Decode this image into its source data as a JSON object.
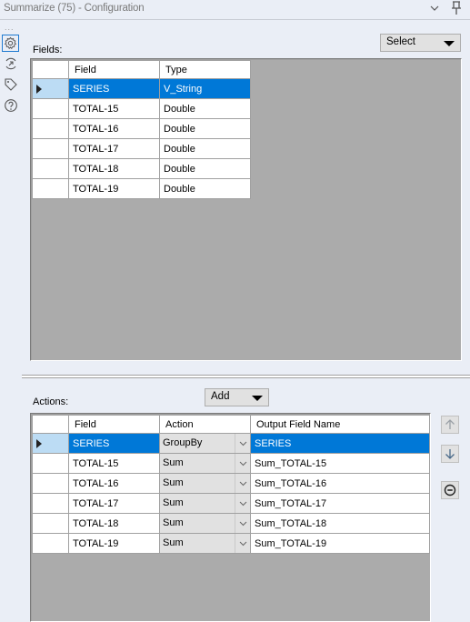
{
  "window": {
    "title": "Summarize (75) - Configuration"
  },
  "sidebar": {
    "more": "...",
    "items": [
      {
        "name": "configuration",
        "icon": "gear-icon",
        "active": true
      },
      {
        "name": "annotation",
        "icon": "arrow-circle-icon",
        "active": false
      },
      {
        "name": "tags",
        "icon": "tag-icon",
        "active": false
      },
      {
        "name": "help",
        "icon": "help-icon",
        "active": false
      }
    ]
  },
  "fields": {
    "label": "Fields:",
    "select_label": "Select",
    "columns": [
      "Field",
      "Type"
    ],
    "rows": [
      {
        "field": "SERIES",
        "type": "V_String",
        "selected": true
      },
      {
        "field": "TOTAL-15",
        "type": "Double"
      },
      {
        "field": "TOTAL-16",
        "type": "Double"
      },
      {
        "field": "TOTAL-17",
        "type": "Double"
      },
      {
        "field": "TOTAL-18",
        "type": "Double"
      },
      {
        "field": "TOTAL-19",
        "type": "Double"
      }
    ]
  },
  "actions": {
    "label": "Actions:",
    "add_label": "Add",
    "columns": [
      "Field",
      "Action",
      "Output Field Name"
    ],
    "rows": [
      {
        "field": "SERIES",
        "action": "GroupBy",
        "output": "SERIES",
        "selected": true
      },
      {
        "field": "TOTAL-15",
        "action": "Sum",
        "output": "Sum_TOTAL-15"
      },
      {
        "field": "TOTAL-16",
        "action": "Sum",
        "output": "Sum_TOTAL-16"
      },
      {
        "field": "TOTAL-17",
        "action": "Sum",
        "output": "Sum_TOTAL-17"
      },
      {
        "field": "TOTAL-18",
        "action": "Sum",
        "output": "Sum_TOTAL-18"
      },
      {
        "field": "TOTAL-19",
        "action": "Sum",
        "output": "Sum_TOTAL-19"
      }
    ],
    "buttons": [
      "move-up",
      "move-down",
      "remove"
    ]
  },
  "colors": {
    "selection": "#0078d7",
    "row_header_selected": "#bcdcf4",
    "grid_background": "#ababab",
    "panel_background": "#eaeef6"
  }
}
